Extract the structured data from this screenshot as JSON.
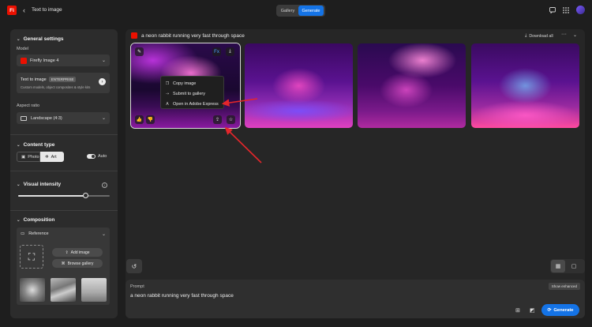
{
  "header": {
    "logo_text": "Fi",
    "back_icon": "chevron-left-icon",
    "title": "Text to image",
    "tabs": [
      {
        "label": "Gallery",
        "active": false
      },
      {
        "label": "Generate",
        "active": true
      }
    ],
    "right_icons": [
      "chat-icon",
      "apps-grid-icon",
      "bell-icon"
    ],
    "accent_color": "#1473e6"
  },
  "sidebar": {
    "general_settings": {
      "title": "General settings",
      "model_label": "Model",
      "model_value": "Firefly Image 4",
      "text_to_image_title": "Text to image",
      "text_to_image_badge": "ENTERPRISE",
      "text_to_image_sub": "Custom models, object composites & style kits",
      "aspect_label": "Aspect ratio",
      "aspect_value": "Landscape (4:3)"
    },
    "content_type": {
      "title": "Content type",
      "options": [
        "Photo",
        "Art"
      ],
      "selected": "Art",
      "auto_label": "Auto",
      "auto_on": true
    },
    "visual_intensity": {
      "title": "Visual intensity",
      "level": 0.74
    },
    "composition": {
      "title": "Composition",
      "reference_label": "Reference",
      "add_image_label": "Add image",
      "browse_gallery_label": "Browse gallery"
    }
  },
  "main": {
    "prompt_title": "a neon rabbit running very fast through space",
    "download_all_label": "Download all",
    "context_menu": {
      "items": [
        {
          "label": "Copy image",
          "icon": "copy-icon"
        },
        {
          "label": "Submit to gallery",
          "icon": "submit-icon"
        },
        {
          "label": "Open in Adobe Express",
          "icon": "adobe-express-icon"
        }
      ]
    },
    "card_overlay_icons": [
      "edit-icon",
      "adobe-express-icon",
      "download-icon",
      "thumbs-up-icon",
      "thumbs-down-icon",
      "share-icon",
      "favorite-icon"
    ],
    "annotation_color": "#e3262b"
  },
  "prompt_box": {
    "label": "Prompt",
    "text": "a neon rabbit running very fast through space",
    "show_enhanced_label": "Show enhanced",
    "generate_label": "Generate"
  }
}
